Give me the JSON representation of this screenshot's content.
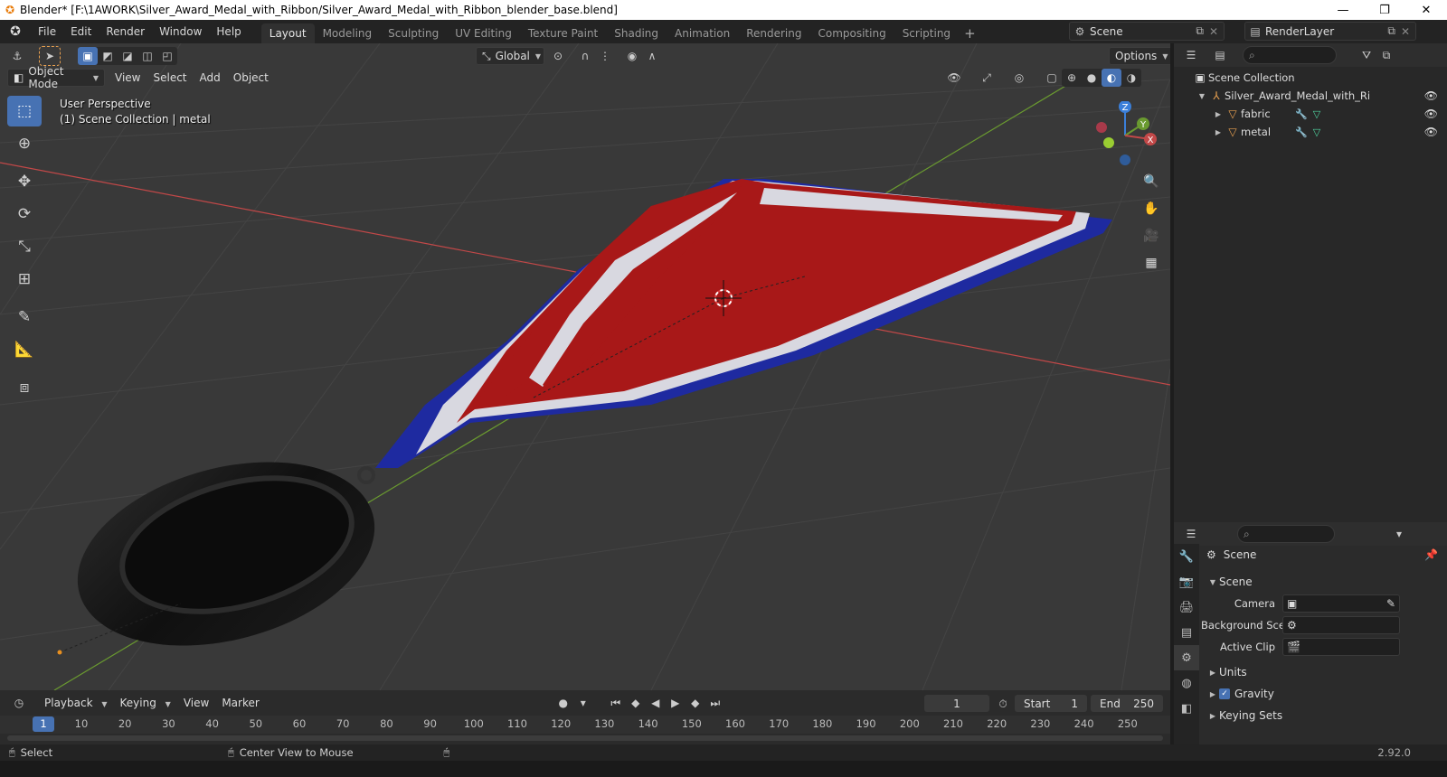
{
  "window": {
    "title": "Blender* [F:\\1AWORK\\Silver_Award_Medal_with_Ribbon/Silver_Award_Medal_with_Ribbon_blender_base.blend]",
    "minimize": "—",
    "restore": "❐",
    "close": "✕"
  },
  "menu": [
    "File",
    "Edit",
    "Render",
    "Window",
    "Help"
  ],
  "workspaces": [
    "Layout",
    "Modeling",
    "Sculpting",
    "UV Editing",
    "Texture Paint",
    "Shading",
    "Animation",
    "Rendering",
    "Compositing",
    "Scripting"
  ],
  "workspace_add": "+",
  "scene_name": "Scene",
  "view_layer": "RenderLayer",
  "viewport": {
    "transform_orientation": "Global",
    "options": "Options",
    "mode": "Object Mode",
    "menus": [
      "View",
      "Select",
      "Add",
      "Object"
    ],
    "perspective_label": "User Perspective",
    "collection_label": "(1) Scene Collection | metal",
    "gizmo_axes": {
      "x": "X",
      "y": "Y",
      "z": "Z"
    }
  },
  "outliner": {
    "root": "Scene Collection",
    "collection": "Silver_Award_Medal_with_Ribbon",
    "objects": [
      "fabric",
      "metal"
    ]
  },
  "properties": {
    "header": "Scene",
    "panel": "Scene",
    "camera_label": "Camera",
    "background_label": "Background Sce...",
    "active_clip_label": "Active Clip",
    "sections": [
      "Units",
      "Gravity",
      "Keying Sets"
    ]
  },
  "timeline": {
    "menus": [
      "Playback",
      "Keying",
      "View",
      "Marker"
    ],
    "current_frame": "1",
    "start_label": "Start",
    "start": "1",
    "end_label": "End",
    "end": "250",
    "ruler": [
      "1",
      "10",
      "20",
      "30",
      "40",
      "50",
      "60",
      "70",
      "80",
      "90",
      "100",
      "110",
      "120",
      "130",
      "140",
      "150",
      "160",
      "170",
      "180",
      "190",
      "200",
      "210",
      "220",
      "230",
      "240",
      "250"
    ]
  },
  "status": {
    "select": "Select",
    "center_view": "Center View to Mouse",
    "version": "2.92.0"
  },
  "colors": {
    "accent": "#4772b3",
    "ribbon_blue": "#1e2aa0",
    "ribbon_red": "#a81818",
    "ribbon_white": "#d8d8e0",
    "axis_x": "#c24848",
    "axis_y": "#6a9a30"
  }
}
